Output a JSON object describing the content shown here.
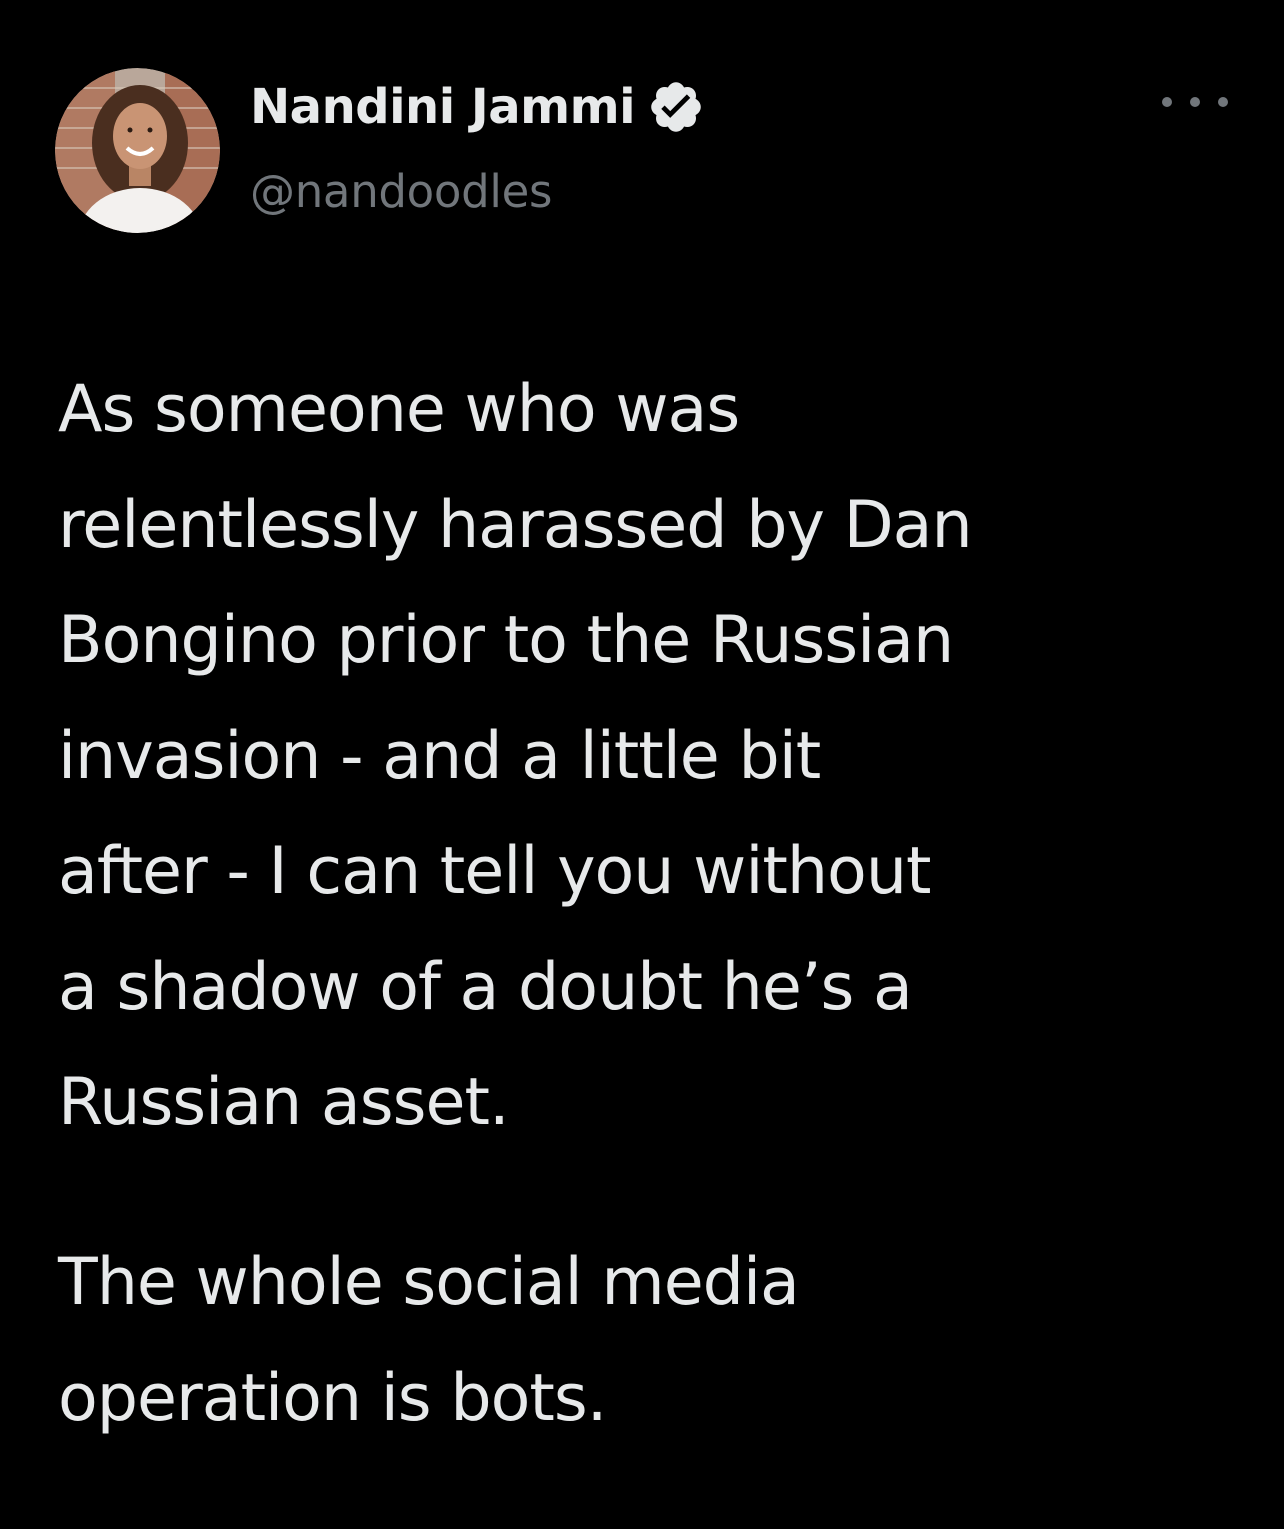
{
  "tweet": {
    "author": {
      "display_name": "Nandini Jammi",
      "handle": "@nandoodles",
      "verified": true,
      "avatar_icon": "avatar-photo"
    },
    "more_icon": "more-horizontal-icon",
    "paragraphs": [
      "As someone who was\nrelentlessly harassed by Dan\nBongino prior to the Russian\ninvasion - and a little bit\nafter - I can tell you without\na shadow of a doubt he’s a\nRussian asset.",
      "The whole social media\noperation is bots."
    ]
  },
  "colors": {
    "background": "#000000",
    "primary_text": "#e7e9ea",
    "secondary_text": "#71767b",
    "verified_badge": "#e7e9ea"
  }
}
